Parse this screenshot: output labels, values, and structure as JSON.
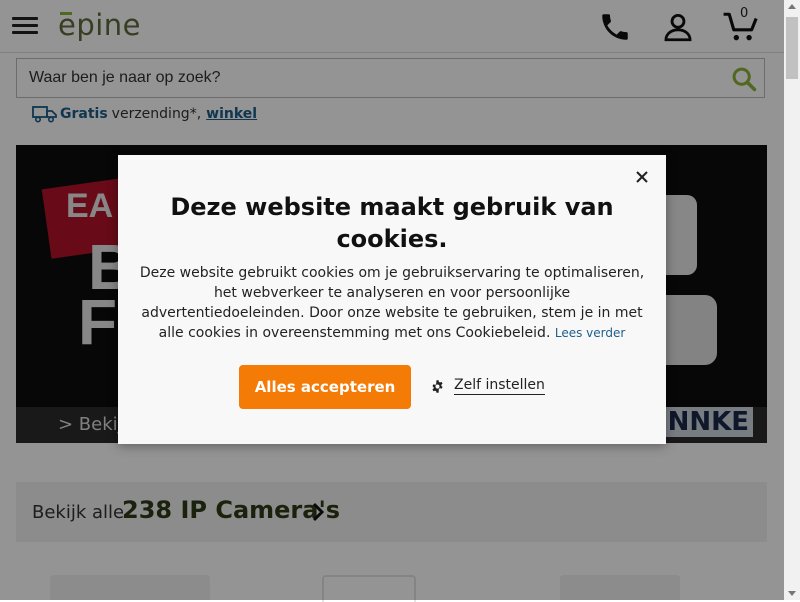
{
  "header": {
    "logo_text": "epine",
    "cart_count": "0",
    "icons": [
      "hamburger-menu-icon",
      "phone-icon",
      "user-icon",
      "cart-icon"
    ]
  },
  "search": {
    "placeholder": "Waar ben je naar op zoek?"
  },
  "shipping": {
    "gratis": "Gratis",
    "text": "verzending*,",
    "link": "winkel"
  },
  "banner": {
    "line1": "EA",
    "line2": "B",
    "line3": "F",
    "cta": "> Bekij",
    "brand": "NNKE"
  },
  "category": {
    "prefix": "Bekijk alle",
    "count_label": "238 IP Camera's"
  },
  "cookie_modal": {
    "title": "Deze website maakt gebruik van cookies.",
    "body": "Deze website gebruikt cookies om je gebruikservaring te optimaliseren, het webverkeer te analyseren en voor persoonlijke advertentiedoeleinden. Door onze website te gebruiken, stem je in met alle cookies in overeenstemming met ons Cookiebeleid.",
    "read_more": "Lees verder",
    "accept_label": "Alles accepteren",
    "settings_label": "Zelf instellen"
  },
  "colors": {
    "accent": "#f47b06",
    "link": "#1d5e8a",
    "logo_green": "#8cb33a",
    "category_count": "#2e3b17"
  }
}
